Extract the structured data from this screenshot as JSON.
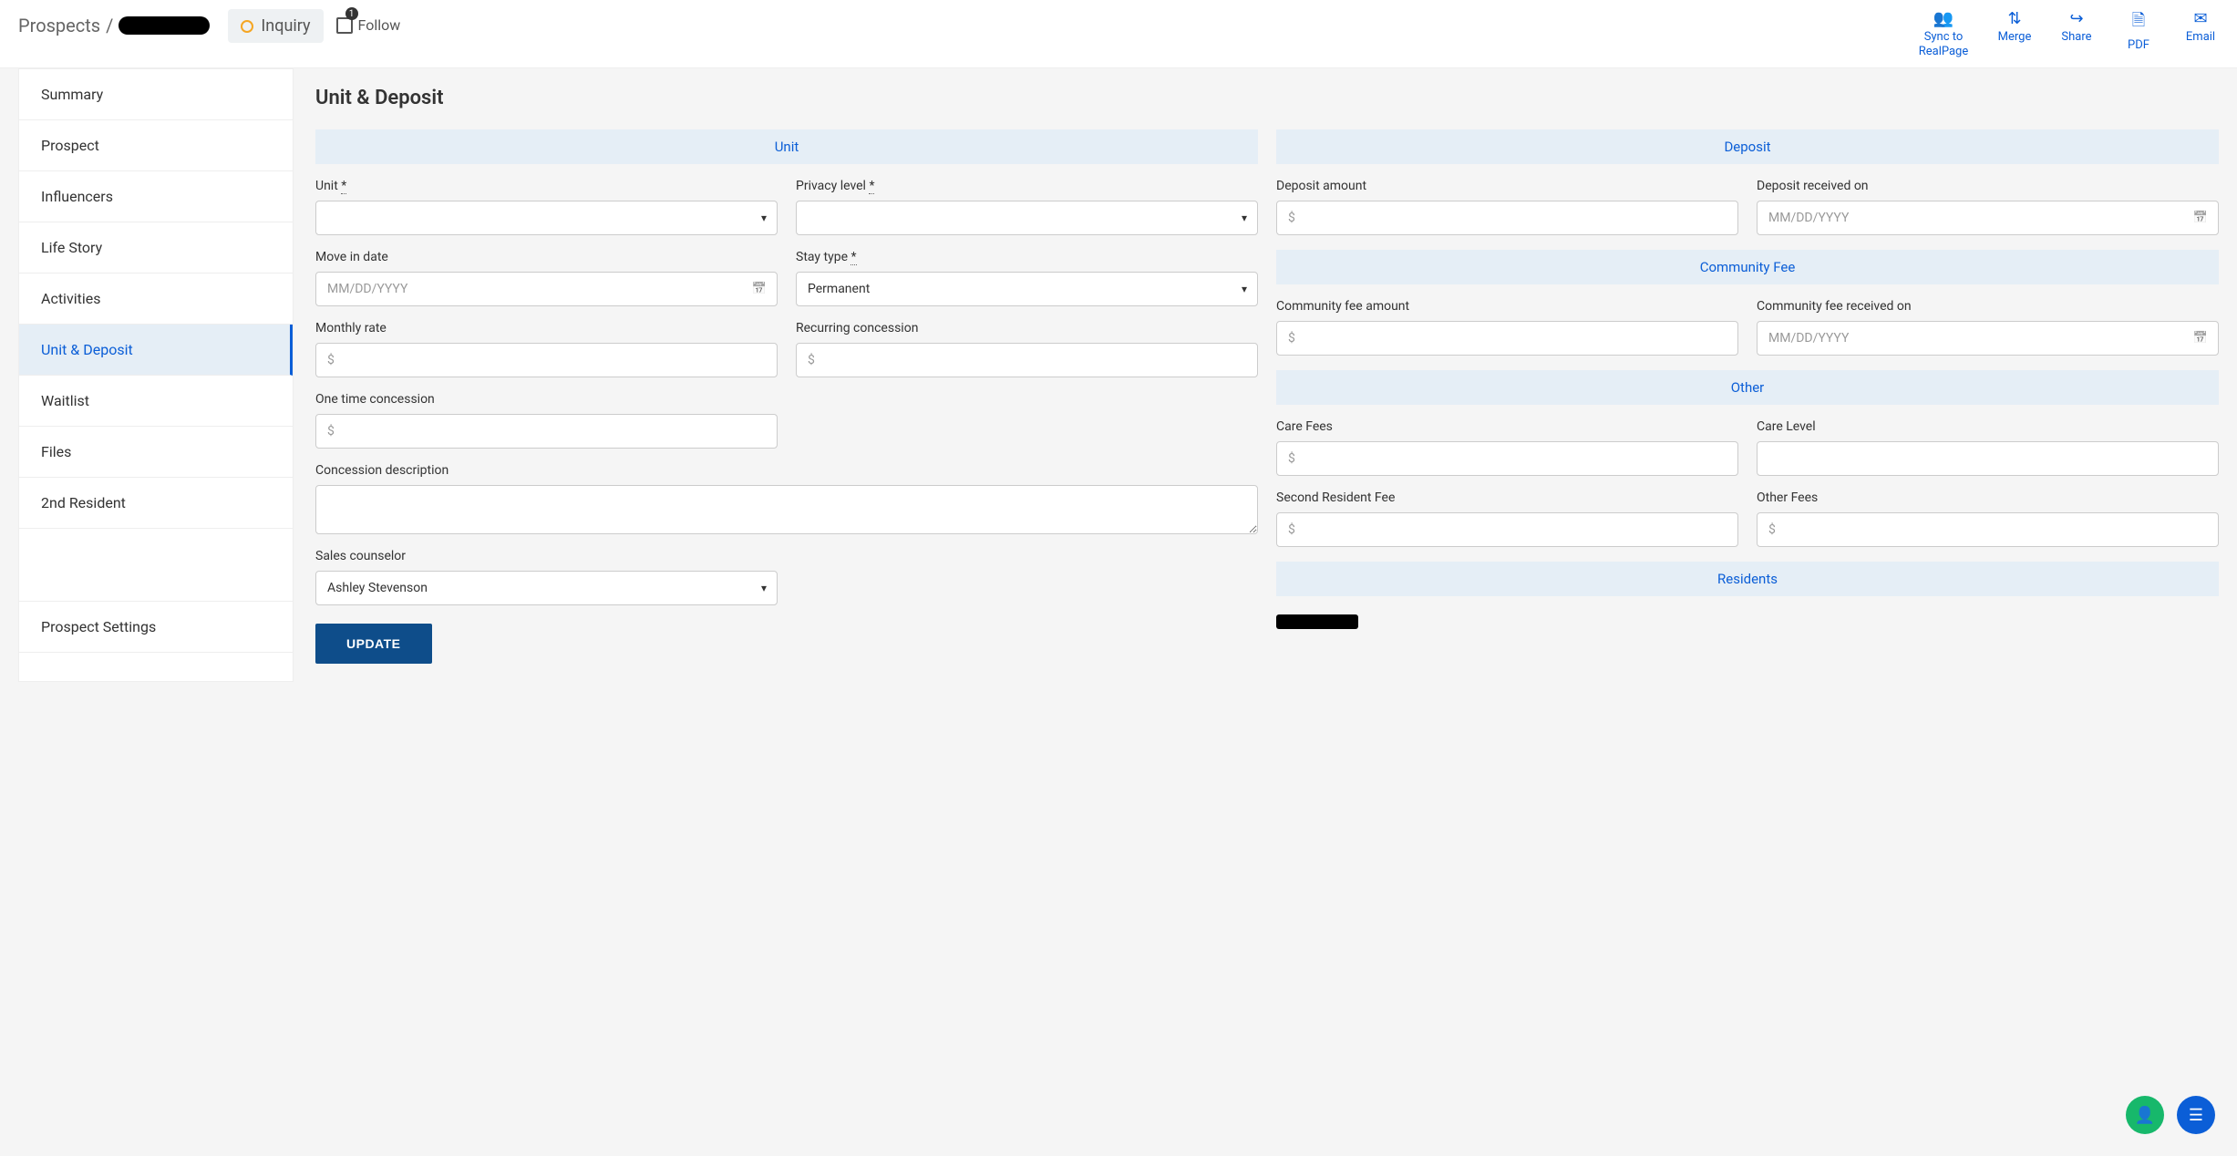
{
  "breadcrumb": {
    "root": "Prospects",
    "sep": "/"
  },
  "status": {
    "label": "Inquiry"
  },
  "follow": {
    "label": "Follow",
    "count": "1"
  },
  "topActions": {
    "sync": "Sync to RealPage",
    "merge": "Merge",
    "share": "Share",
    "pdf": "PDF",
    "email": "Email"
  },
  "nav": {
    "summary": "Summary",
    "prospect": "Prospect",
    "influencers": "Influencers",
    "lifeStory": "Life Story",
    "activities": "Activities",
    "unitDeposit": "Unit & Deposit",
    "waitlist": "Waitlist",
    "files": "Files",
    "secondResident": "2nd Resident",
    "prospectSettings": "Prospect Settings"
  },
  "page": {
    "title": "Unit & Deposit"
  },
  "sections": {
    "unit": "Unit",
    "deposit": "Deposit",
    "communityFee": "Community Fee",
    "other": "Other",
    "residents": "Residents"
  },
  "labels": {
    "unit": "Unit ",
    "privacyLevel": "Privacy level ",
    "moveInDate": "Move in date",
    "stayType": "Stay type ",
    "monthlyRate": "Monthly rate",
    "recurringConcession": "Recurring concession",
    "oneTimeConcession": "One time concession",
    "concessionDescription": "Concession description",
    "salesCounselor": "Sales counselor",
    "depositAmount": "Deposit amount",
    "depositReceivedOn": "Deposit received on",
    "communityFeeAmount": "Community fee amount",
    "communityFeeReceivedOn": "Community fee received on",
    "careFees": "Care Fees",
    "careLevel": "Care Level",
    "secondResidentFee": "Second Resident Fee",
    "otherFees": "Other Fees",
    "required": "*"
  },
  "values": {
    "stayType": "Permanent",
    "salesCounselor": "Ashley Stevenson"
  },
  "placeholders": {
    "date": "MM/DD/YYYY",
    "currency": "$"
  },
  "buttons": {
    "update": "UPDATE"
  }
}
